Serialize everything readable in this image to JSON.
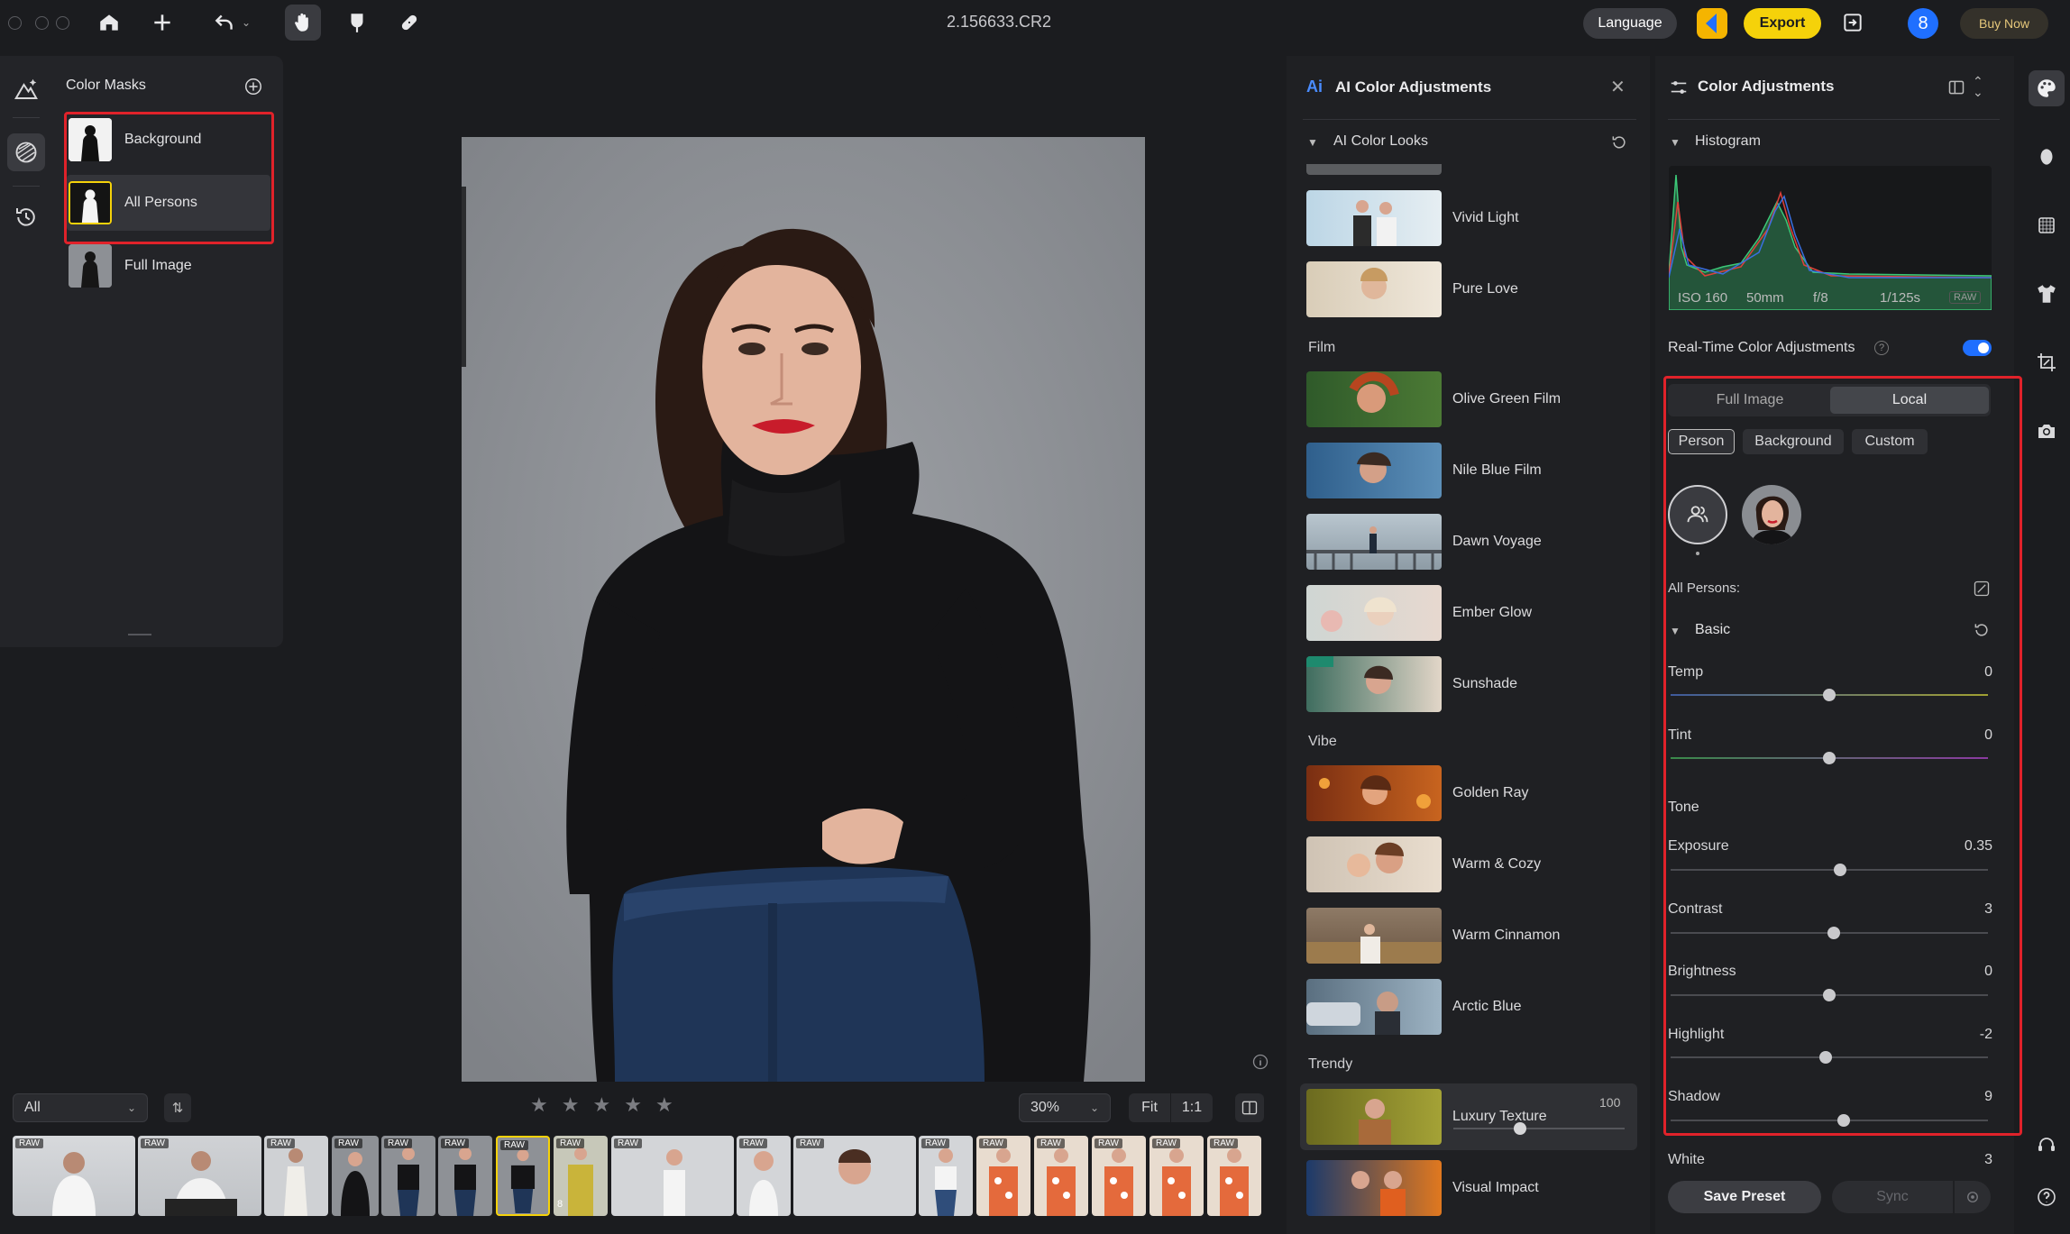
{
  "window": {
    "file_title": "2.156633.CR2"
  },
  "topbar": {
    "language": "Language",
    "export": "Export",
    "badge_count": "8",
    "buy_now": "Buy Now"
  },
  "masks": {
    "title": "Color Masks",
    "items": [
      {
        "label": "Background"
      },
      {
        "label": "All Persons"
      },
      {
        "label": "Full Image"
      }
    ]
  },
  "filmstrip": {
    "filter": "All",
    "zoom": "30%",
    "fit": "Fit",
    "one_to_one": "1:1",
    "raw": "RAW",
    "stack_count": "8"
  },
  "ai_panel": {
    "title": "AI Color Adjustments",
    "section": "AI Color Looks",
    "looks": [
      {
        "label": "Vivid Light"
      },
      {
        "label": "Pure Love"
      }
    ],
    "film_label": "Film",
    "film": [
      {
        "label": "Olive Green Film"
      },
      {
        "label": "Nile Blue Film"
      },
      {
        "label": "Dawn Voyage"
      },
      {
        "label": "Ember Glow"
      },
      {
        "label": "Sunshade"
      }
    ],
    "vibe_label": "Vibe",
    "vibe": [
      {
        "label": "Golden Ray"
      },
      {
        "label": "Warm & Cozy"
      },
      {
        "label": "Warm Cinnamon"
      },
      {
        "label": "Arctic Blue"
      }
    ],
    "trendy_label": "Trendy",
    "trendy": [
      {
        "label": "Luxury Texture",
        "value": "100",
        "amount": 1.0
      },
      {
        "label": "Visual Impact"
      }
    ]
  },
  "color_panel": {
    "title": "Color Adjustments",
    "histogram_label": "Histogram",
    "exif": {
      "iso": "ISO 160",
      "focal": "50mm",
      "aperture": "f/8",
      "shutter": "1/125s",
      "raw": "RAW"
    },
    "realtime_label": "Real-Time Color Adjustments",
    "realtime_on": true,
    "tabs": [
      "Full Image",
      "Local"
    ],
    "chips": [
      "Person",
      "Background",
      "Custom"
    ],
    "all_persons": "All Persons:",
    "basic": "Basic",
    "tone": "Tone",
    "sliders": [
      {
        "label": "Temp",
        "value": "0",
        "pos": 0.5
      },
      {
        "label": "Tint",
        "value": "0",
        "pos": 0.5
      },
      {
        "label": "Exposure",
        "value": "0.35",
        "pos": 0.535
      },
      {
        "label": "Contrast",
        "value": "3",
        "pos": 0.515
      },
      {
        "label": "Brightness",
        "value": "0",
        "pos": 0.5
      },
      {
        "label": "Highlight",
        "value": "-2",
        "pos": 0.49
      },
      {
        "label": "Shadow",
        "value": "9",
        "pos": 0.545
      }
    ],
    "white_label": "White",
    "white_value": "3",
    "save_preset": "Save Preset",
    "sync": "Sync"
  },
  "colors": {
    "accent": "#1f6fff",
    "export": "#f5d20a",
    "highlight": "#e0222a"
  }
}
